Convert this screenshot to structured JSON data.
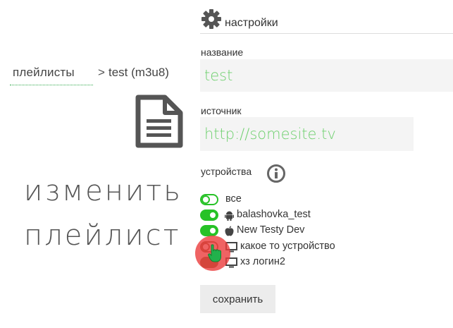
{
  "breadcrumb": {
    "link_label": "плейлисты",
    "separator": ">",
    "current": "test (m3u8)"
  },
  "main_title": {
    "line1": "изменить",
    "line2": "плейлист"
  },
  "icons": {
    "document": "file-text-icon",
    "settings": "gear-icon",
    "info": "info-icon",
    "android": "android-icon",
    "apple": "apple-icon",
    "desktop": "monitor-icon",
    "cursor": "hand-pointer-icon"
  },
  "settings": {
    "title": "настройки",
    "name_label": "название",
    "name_value": "test",
    "source_label": "источник",
    "source_value": "http://somesite.tv",
    "devices_label": "устройства"
  },
  "devices": [
    {
      "label": "все",
      "enabled": false,
      "icon": ""
    },
    {
      "label": "balashovka_test",
      "enabled": true,
      "icon": "android-icon"
    },
    {
      "label": "New Testy Dev",
      "enabled": true,
      "icon": "apple-icon"
    },
    {
      "label": "какое то устройство",
      "enabled": false,
      "icon": "monitor-icon"
    },
    {
      "label": "хз логин2",
      "enabled": false,
      "icon": "monitor-icon"
    }
  ],
  "save_button": {
    "label": "сохранить"
  },
  "colors": {
    "accent_green": "#27c227",
    "field_text_green": "#6fd06f",
    "field_bg": "#f4f4f4",
    "click_highlight": "#eb3c3c",
    "breadcrumb_underline": "#2ea84a"
  }
}
